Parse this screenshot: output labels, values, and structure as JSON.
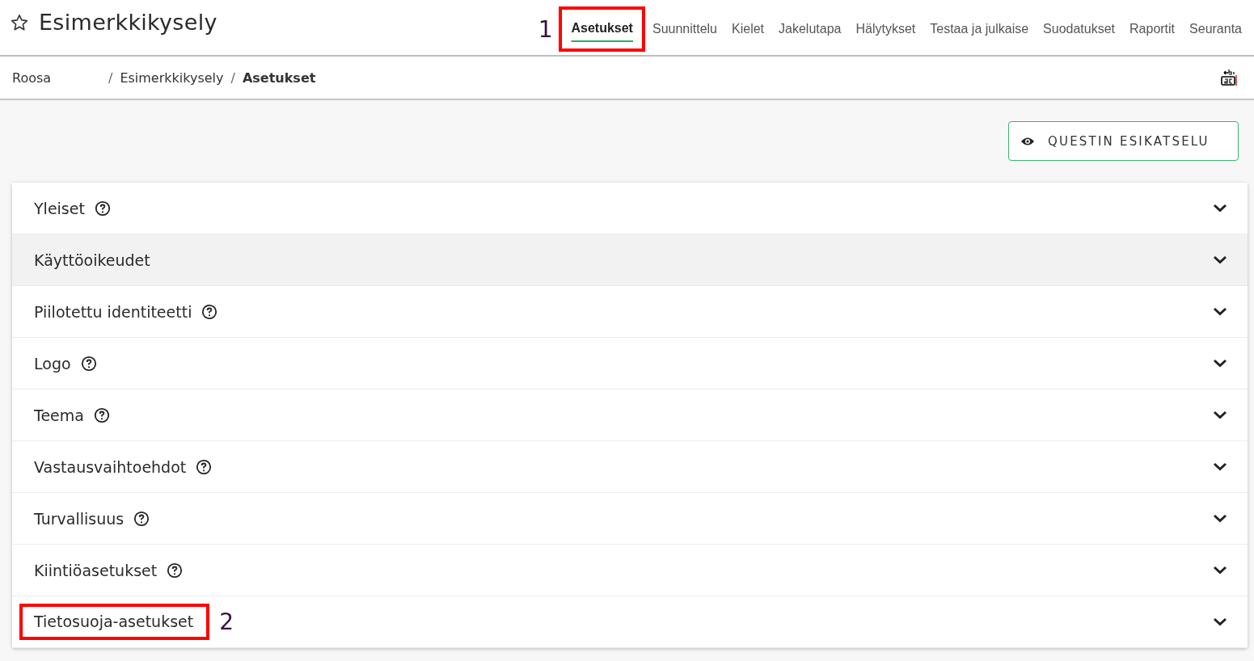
{
  "header": {
    "title": "Esimerkkikysely"
  },
  "tabs": [
    {
      "label": "Asetukset",
      "selected": true,
      "callout": "1"
    },
    {
      "label": "Suunnittelu",
      "selected": false
    },
    {
      "label": "Kielet",
      "selected": false
    },
    {
      "label": "Jakelutapa",
      "selected": false
    },
    {
      "label": "Hälytykset",
      "selected": false
    },
    {
      "label": "Testaa ja julkaise",
      "selected": false
    },
    {
      "label": "Suodatukset",
      "selected": false
    },
    {
      "label": "Raportit",
      "selected": false
    },
    {
      "label": "Seuranta",
      "selected": false
    }
  ],
  "breadcrumb": [
    {
      "label": "Roosa",
      "current": false
    },
    {
      "separator": "/",
      "label": "Esimerkkikysely",
      "current": false
    },
    {
      "separator": "/",
      "label": "Asetukset",
      "current": true
    }
  ],
  "preview_button": {
    "label": "QUESTIN ESIKATSELU"
  },
  "sections": [
    {
      "title": "Yleiset",
      "help": true,
      "hovered": false
    },
    {
      "title": "Käyttöoikeudet",
      "help": false,
      "hovered": true
    },
    {
      "title": "Piilotettu identiteetti",
      "help": true,
      "hovered": false
    },
    {
      "title": "Logo",
      "help": true,
      "hovered": false
    },
    {
      "title": "Teema",
      "help": true,
      "hovered": false
    },
    {
      "title": "Vastausvaihtoehdot",
      "help": true,
      "hovered": false
    },
    {
      "title": "Turvallisuus",
      "help": true,
      "hovered": false
    },
    {
      "title": "Kiintiöasetukset",
      "help": true,
      "hovered": false
    },
    {
      "title": "Tietosuoja-asetukset",
      "help": false,
      "hovered": false,
      "callout": "2"
    }
  ]
}
